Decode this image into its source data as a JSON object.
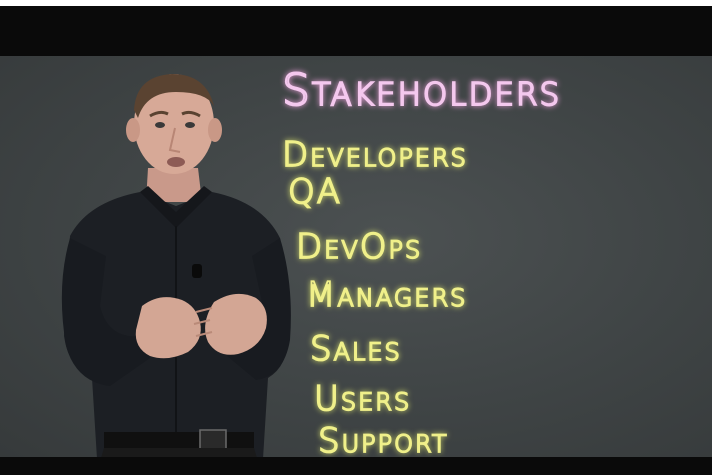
{
  "board": {
    "heading": "Stakeholders",
    "items": [
      {
        "label": "Developers"
      },
      {
        "label": "QA"
      },
      {
        "label": "DevOps"
      },
      {
        "label": "Managers"
      },
      {
        "label": "Sales"
      },
      {
        "label": "Users"
      },
      {
        "label": "Support"
      }
    ]
  },
  "colors": {
    "board": "#43484a",
    "heading_ink": "#f4c8ee",
    "list_ink": "#f0f08a",
    "letterbox": "#0a0a0a"
  }
}
